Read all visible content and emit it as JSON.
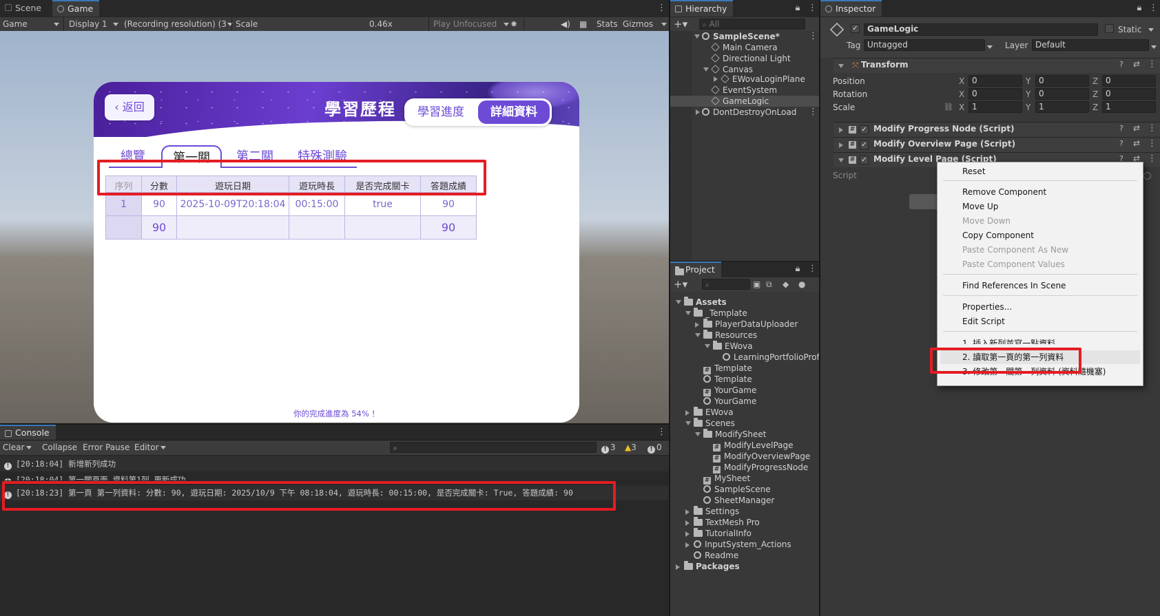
{
  "scene_tab": "Scene",
  "game_tab": "Game",
  "game_toolbar": {
    "mode": "Game",
    "display": "Display 1",
    "resolution": "(Recording resolution) (3",
    "scale_label": "Scale",
    "scale_value": "0.46x",
    "play_mode": "Play Unfocused",
    "stats": "Stats",
    "gizmos": "Gizmos"
  },
  "game": {
    "back_label": "返回",
    "title": "學習歷程",
    "toggle_progress": "學習進度",
    "toggle_detail": "詳細資料",
    "tabs": [
      "總覽",
      "第一關",
      "第二關",
      "特殊測驗"
    ],
    "columns": [
      "序列",
      "分數",
      "遊玩日期",
      "遊玩時長",
      "是否完成關卡",
      "答題成績"
    ],
    "rows": [
      [
        "1",
        "90",
        "2025-10-09T20:18:04",
        "00:15:00",
        "true",
        "90"
      ]
    ],
    "summary": [
      "",
      "90",
      "",
      "",
      "",
      "90"
    ],
    "footer": "你的完成進度為 54% ！"
  },
  "hierarchy": {
    "tab": "Hierarchy",
    "search_placeholder": "All",
    "items": [
      {
        "label": "SampleScene*"
      },
      {
        "label": "Main Camera"
      },
      {
        "label": "Directional Light"
      },
      {
        "label": "Canvas"
      },
      {
        "label": "EWovaLoginPlane"
      },
      {
        "label": "EventSystem"
      },
      {
        "label": "GameLogic"
      },
      {
        "label": "DontDestroyOnLoad"
      }
    ]
  },
  "project": {
    "tab": "Project",
    "items": [
      {
        "label": "Assets",
        "kind": "folder"
      },
      {
        "label": "_Template",
        "kind": "folder"
      },
      {
        "label": "PlayerDataUploader",
        "kind": "folder"
      },
      {
        "label": "Resources",
        "kind": "folder"
      },
      {
        "label": "EWova",
        "kind": "folder"
      },
      {
        "label": "LearningPortfolioProfi",
        "kind": "asset"
      },
      {
        "label": "Template",
        "kind": "script"
      },
      {
        "label": "Template",
        "kind": "scene"
      },
      {
        "label": "YourGame",
        "kind": "script"
      },
      {
        "label": "YourGame",
        "kind": "scene"
      },
      {
        "label": "EWova",
        "kind": "folder"
      },
      {
        "label": "Scenes",
        "kind": "folder"
      },
      {
        "label": "ModifySheet",
        "kind": "folder"
      },
      {
        "label": "ModifyLevelPage",
        "kind": "script"
      },
      {
        "label": "ModifyOverviewPage",
        "kind": "script"
      },
      {
        "label": "ModifyProgressNode",
        "kind": "script"
      },
      {
        "label": "MySheet",
        "kind": "script"
      },
      {
        "label": "SampleScene",
        "kind": "scene"
      },
      {
        "label": "SheetManager",
        "kind": "scene"
      },
      {
        "label": "Settings",
        "kind": "folder"
      },
      {
        "label": "TextMesh Pro",
        "kind": "folder"
      },
      {
        "label": "TutorialInfo",
        "kind": "folder"
      },
      {
        "label": "InputSystem_Actions",
        "kind": "asset"
      },
      {
        "label": "Readme",
        "kind": "asset"
      },
      {
        "label": "Packages",
        "kind": "folder"
      }
    ]
  },
  "inspector": {
    "tab": "Inspector",
    "object_name": "GameLogic",
    "static_label": "Static",
    "tag_label": "Tag",
    "tag_value": "Untagged",
    "layer_label": "Layer",
    "layer_value": "Default",
    "transform": {
      "title": "Transform",
      "rows": [
        {
          "label": "Position",
          "x": "0",
          "y": "0",
          "z": "0"
        },
        {
          "label": "Rotation",
          "x": "0",
          "y": "0",
          "z": "0"
        },
        {
          "label": "Scale",
          "x": "1",
          "y": "1",
          "z": "1"
        }
      ]
    },
    "components": [
      "Modify Progress Node (Script)",
      "Modify Overview Page (Script)",
      "Modify Level Page (Script)"
    ],
    "script_label": "Script"
  },
  "context_menu": {
    "items": [
      {
        "label": "Reset",
        "enabled": true
      },
      {
        "label": "Remove Component",
        "enabled": true
      },
      {
        "label": "Move Up",
        "enabled": true
      },
      {
        "label": "Move Down",
        "enabled": false
      },
      {
        "label": "Copy Component",
        "enabled": true
      },
      {
        "label": "Paste Component As New",
        "enabled": false
      },
      {
        "label": "Paste Component Values",
        "enabled": false
      },
      {
        "label": "Find References In Scene",
        "enabled": true
      },
      {
        "label": "Properties...",
        "enabled": true
      },
      {
        "label": "Edit Script",
        "enabled": true
      },
      {
        "label": "1. 插入新列並寫一點資料",
        "enabled": true
      },
      {
        "label": "2. 讀取第一頁的第一列資料",
        "enabled": true
      },
      {
        "label": "3. 修改第一關第一列資料 (資料隨機塞)",
        "enabled": true
      }
    ]
  },
  "console": {
    "tab": "Console",
    "clear": "Clear",
    "collapse": "Collapse",
    "error_pause": "Error Pause",
    "editor": "Editor",
    "count_info": "3",
    "count_warn": "3",
    "count_error": "0",
    "logs": [
      "[20:18:04] 新增新列成功",
      "[20:18:04] 第一關頁面 資料第1列 更新成功",
      "[20:18:23] 第一頁 第一列資料: 分數: 90, 遊玩日期: 2025/10/9 下午 08:18:04, 遊玩時長: 00:15:00, 是否完成關卡: True, 答題成績: 90"
    ]
  }
}
